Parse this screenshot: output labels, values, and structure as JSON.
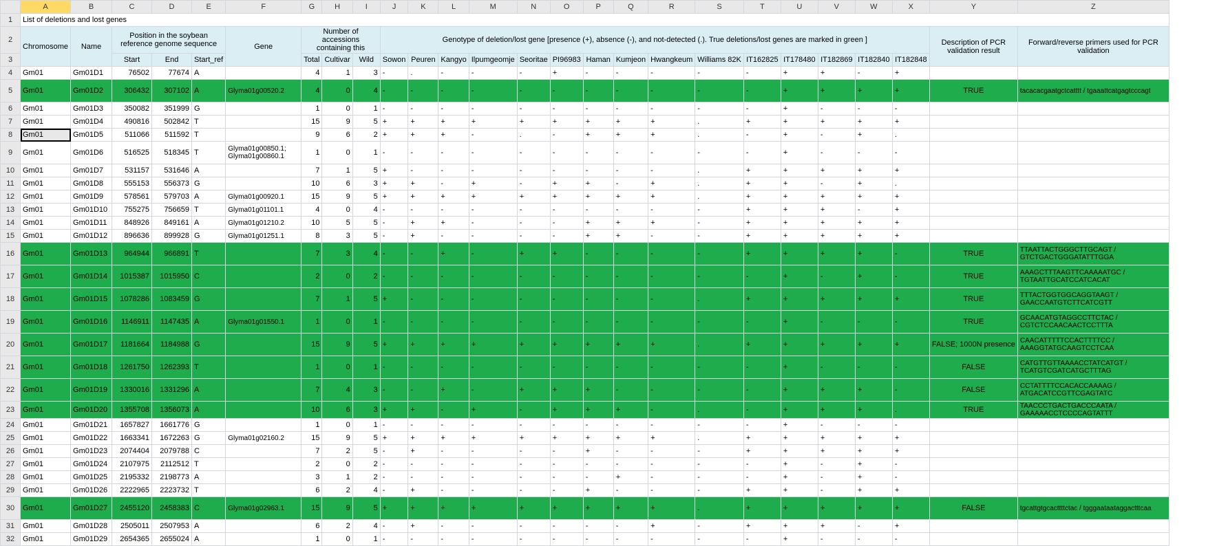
{
  "columns": [
    "",
    "A",
    "B",
    "C",
    "D",
    "E",
    "F",
    "G",
    "H",
    "I",
    "J",
    "K",
    "L",
    "M",
    "N",
    "O",
    "P",
    "Q",
    "R",
    "S",
    "T",
    "U",
    "V",
    "W",
    "X",
    "Y",
    "Z"
  ],
  "row1": {
    "A": "List of deletions and lost genes"
  },
  "row2": {
    "pos_group": "Position in the soybean reference genome sequence",
    "num_group": "Number of accessions containing this",
    "geno_group": "Genotype of deletion/lost gene [presence (+), absence (-), and not-detected (.). True deletions/lost genes are marked in green ]",
    "pcr": "Description of PCR validation result",
    "primers": "Forward/reverse primers used for PCR validation"
  },
  "row3": {
    "A": "Chromosome",
    "B": "Name",
    "C": "Start",
    "D": "End",
    "E": "Start_ref",
    "F": "Gene",
    "G": "Total",
    "H": "Cultivar",
    "I": "Wild",
    "J": "Sowon",
    "K": "Peuren",
    "L": "Kangyo",
    "M": "Ilpumgeomje",
    "N": "Seoritae",
    "O": "PI96983",
    "P": "Haman",
    "Q": "Kumjeon",
    "R": "Hwangkeum",
    "S": "Williams 82K",
    "T": "IT162825",
    "U": "IT178480",
    "V": "IT182869",
    "W": "IT182840",
    "X": "IT182848"
  },
  "rows": [
    {
      "n": 4,
      "A": "Gm01",
      "B": "Gm01D1",
      "C": "76502",
      "D": "77674",
      "E": "A",
      "F": "",
      "G": "4",
      "H": "1",
      "I": "3",
      "J": "-",
      "K": ".",
      "L": "-",
      "M": "-",
      "N": "-",
      "O": "+",
      "P": "-",
      "Q": "-",
      "R": "-",
      "S": "-",
      "T": "-",
      "U": "+",
      "V": "+",
      "W": "-",
      "X": "+",
      "Y": "",
      "Z": ""
    },
    {
      "n": 5,
      "green": true,
      "tall": true,
      "A": "Gm01",
      "B": "Gm01D2",
      "C": "306432",
      "D": "307102",
      "E": "A",
      "F": "Glyma01g00520.2",
      "G": "4",
      "H": "0",
      "I": "4",
      "J": "-",
      "K": "-",
      "L": "-",
      "M": "-",
      "N": "-",
      "O": "-",
      "P": "-",
      "Q": "-",
      "R": "-",
      "S": "-",
      "T": "-",
      "U": "+",
      "V": "+",
      "W": "+",
      "X": "+",
      "Y": "TRUE",
      "Z": "tacacacgaatgctcatttt / tgaaattcatgagtcccagt"
    },
    {
      "n": 6,
      "A": "Gm01",
      "B": "Gm01D3",
      "C": "350082",
      "D": "351999",
      "E": "G",
      "F": "",
      "G": "1",
      "H": "0",
      "I": "1",
      "J": "-",
      "K": "-",
      "L": "-",
      "M": "-",
      "N": "-",
      "O": "-",
      "P": "-",
      "Q": "-",
      "R": "-",
      "S": "-",
      "T": "-",
      "U": "+",
      "V": "-",
      "W": "-",
      "X": "-",
      "Y": "",
      "Z": ""
    },
    {
      "n": 7,
      "A": "Gm01",
      "B": "Gm01D4",
      "C": "490816",
      "D": "502842",
      "E": "T",
      "F": "",
      "G": "15",
      "H": "9",
      "I": "5",
      "J": "+",
      "K": "+",
      "L": "+",
      "M": "+",
      "N": "+",
      "O": "+",
      "P": "+",
      "Q": "+",
      "R": "+",
      "S": ".",
      "T": "+",
      "U": "+",
      "V": "+",
      "W": "+",
      "X": "+",
      "Y": "",
      "Z": ""
    },
    {
      "n": 8,
      "sel": true,
      "A": "Gm01",
      "B": "Gm01D5",
      "C": "511066",
      "D": "511592",
      "E": "T",
      "F": "",
      "G": "9",
      "H": "6",
      "I": "2",
      "J": "+",
      "K": "+",
      "L": "+",
      "M": "-",
      "N": ".",
      "O": "-",
      "P": "+",
      "Q": "+",
      "R": "+",
      "S": ".",
      "T": "-",
      "U": "+",
      "V": "-",
      "W": "+",
      "X": ".",
      "Y": "",
      "Z": ""
    },
    {
      "n": 9,
      "tall": true,
      "A": "Gm01",
      "B": "Gm01D6",
      "C": "516525",
      "D": "518345",
      "E": "T",
      "F": "Glyma01g00850.1; Glyma01g00860.1",
      "G": "1",
      "H": "0",
      "I": "1",
      "J": "-",
      "K": "-",
      "L": "-",
      "M": "-",
      "N": "-",
      "O": "-",
      "P": "-",
      "Q": "-",
      "R": "-",
      "S": "-",
      "T": "-",
      "U": "+",
      "V": "-",
      "W": "-",
      "X": "-",
      "Y": "",
      "Z": ""
    },
    {
      "n": 10,
      "A": "Gm01",
      "B": "Gm01D7",
      "C": "531157",
      "D": "531646",
      "E": "A",
      "F": "",
      "G": "7",
      "H": "1",
      "I": "5",
      "J": "+",
      "K": "-",
      "L": "-",
      "M": "-",
      "N": "-",
      "O": "-",
      "P": "-",
      "Q": "-",
      "R": "-",
      "S": ".",
      "T": "+",
      "U": "+",
      "V": "+",
      "W": "+",
      "X": "+",
      "Y": "",
      "Z": ""
    },
    {
      "n": 11,
      "A": "Gm01",
      "B": "Gm01D8",
      "C": "555153",
      "D": "556373",
      "E": "G",
      "F": "",
      "G": "10",
      "H": "6",
      "I": "3",
      "J": "+",
      "K": "+",
      "L": "-",
      "M": "+",
      "N": "-",
      "O": "+",
      "P": "+",
      "Q": "-",
      "R": "+",
      "S": ".",
      "T": "+",
      "U": "+",
      "V": "-",
      "W": "+",
      "X": ".",
      "Y": "",
      "Z": ""
    },
    {
      "n": 12,
      "A": "Gm01",
      "B": "Gm01D9",
      "C": "578561",
      "D": "579703",
      "E": "A",
      "F": "Glyma01g00920.1",
      "G": "15",
      "H": "9",
      "I": "5",
      "J": "+",
      "K": "+",
      "L": "+",
      "M": "+",
      "N": "+",
      "O": "+",
      "P": "+",
      "Q": "+",
      "R": "+",
      "S": ".",
      "T": "+",
      "U": "+",
      "V": "+",
      "W": "+",
      "X": "+",
      "Y": "",
      "Z": ""
    },
    {
      "n": 13,
      "A": "Gm01",
      "B": "Gm01D10",
      "C": "755275",
      "D": "756659",
      "E": "T",
      "F": "Glyma01g01101.1",
      "G": "4",
      "H": "0",
      "I": "4",
      "J": "-",
      "K": "-",
      "L": "-",
      "M": "-",
      "N": "-",
      "O": "-",
      "P": "-",
      "Q": "-",
      "R": "-",
      "S": "-",
      "T": "+",
      "U": "+",
      "V": "+",
      "W": "-",
      "X": "+",
      "Y": "",
      "Z": ""
    },
    {
      "n": 14,
      "A": "Gm01",
      "B": "Gm01D11",
      "C": "848926",
      "D": "849161",
      "E": "A",
      "F": "Glyma01g01210.2",
      "G": "10",
      "H": "5",
      "I": "5",
      "J": "-",
      "K": "+",
      "L": "+",
      "M": "-",
      "N": "-",
      "O": "-",
      "P": "+",
      "Q": "+",
      "R": "+",
      "S": "-",
      "T": "+",
      "U": "+",
      "V": "+",
      "W": "+",
      "X": "+",
      "Y": "",
      "Z": ""
    },
    {
      "n": 15,
      "A": "Gm01",
      "B": "Gm01D12",
      "C": "896636",
      "D": "899928",
      "E": "G",
      "F": "Glyma01g01251.1",
      "G": "8",
      "H": "3",
      "I": "5",
      "J": "-",
      "K": "+",
      "L": "-",
      "M": "-",
      "N": "-",
      "O": "-",
      "P": "+",
      "Q": "+",
      "R": "-",
      "S": "-",
      "T": "+",
      "U": "+",
      "V": "+",
      "W": "+",
      "X": "+",
      "Y": "",
      "Z": ""
    },
    {
      "n": 16,
      "green": true,
      "tall": true,
      "A": "Gm01",
      "B": "Gm01D13",
      "C": "964944",
      "D": "966891",
      "E": "T",
      "F": "",
      "G": "7",
      "H": "3",
      "I": "4",
      "J": "-",
      "K": "-",
      "L": "+",
      "M": "-",
      "N": "+",
      "O": "+",
      "P": "-",
      "Q": "-",
      "R": "-",
      "S": "-",
      "T": "+",
      "U": "+",
      "V": "+",
      "W": "+",
      "X": "-",
      "Y": "TRUE",
      "Z": "TTAATTACTGGGCTTGCAGT / GTCTGACTGGGATATTTGGA"
    },
    {
      "n": 17,
      "green": true,
      "tall": true,
      "A": "Gm01",
      "B": "Gm01D14",
      "C": "1015387",
      "D": "1015950",
      "E": "C",
      "F": "",
      "G": "2",
      "H": "0",
      "I": "2",
      "J": "-",
      "K": "-",
      "L": "-",
      "M": "-",
      "N": "-",
      "O": "-",
      "P": "-",
      "Q": "-",
      "R": "-",
      "S": "-",
      "T": "-",
      "U": "+",
      "V": "-",
      "W": "+",
      "X": "-",
      "Y": "TRUE",
      "Z": "AAAGCTTTAAGTTCAAAAATGC / TGTAATTGCATCCATCACAT"
    },
    {
      "n": 18,
      "green": true,
      "tall": true,
      "A": "Gm01",
      "B": "Gm01D15",
      "C": "1078286",
      "D": "1083459",
      "E": "G",
      "F": "",
      "G": "7",
      "H": "1",
      "I": "5",
      "J": "+",
      "K": "-",
      "L": "-",
      "M": "-",
      "N": "-",
      "O": "-",
      "P": "-",
      "Q": "-",
      "R": "-",
      "S": ".",
      "T": "+",
      "U": "+",
      "V": "+",
      "W": "+",
      "X": "+",
      "Y": "TRUE",
      "Z": "TTTACTGGTGGCAGGTAAGT / GAACCAATGTCTTCATCGTT"
    },
    {
      "n": 19,
      "green": true,
      "tall": true,
      "A": "Gm01",
      "B": "Gm01D16",
      "C": "1146911",
      "D": "1147435",
      "E": "A",
      "F": "Glyma01g01550.1",
      "G": "1",
      "H": "0",
      "I": "1",
      "J": "-",
      "K": "-",
      "L": "-",
      "M": "-",
      "N": "-",
      "O": "-",
      "P": "-",
      "Q": "-",
      "R": "-",
      "S": "-",
      "T": "-",
      "U": "+",
      "V": "-",
      "W": "-",
      "X": "-",
      "Y": "TRUE",
      "Z": "GCAACATGTAGGCCTTCTAC / CGTCTCCAACAACTCCTTTA"
    },
    {
      "n": 20,
      "green": true,
      "tall": true,
      "A": "Gm01",
      "B": "Gm01D17",
      "C": "1181664",
      "D": "1184988",
      "E": "G",
      "F": "",
      "G": "15",
      "H": "9",
      "I": "5",
      "J": "+",
      "K": "+",
      "L": "+",
      "M": "+",
      "N": "+",
      "O": "+",
      "P": "+",
      "Q": "+",
      "R": "+",
      "S": ".",
      "T": "+",
      "U": "+",
      "V": "+",
      "W": "+",
      "X": "+",
      "Y": "FALSE; 1000N presence",
      "Z": "CAACATTTTTCCACTTTTCC / AAAGGTATGCAAGTCCTCAA"
    },
    {
      "n": 21,
      "green": true,
      "tall": true,
      "A": "Gm01",
      "B": "Gm01D18",
      "C": "1261750",
      "D": "1262393",
      "E": "T",
      "F": "",
      "G": "1",
      "H": "0",
      "I": "1",
      "J": "-",
      "K": "-",
      "L": "-",
      "M": "-",
      "N": "-",
      "O": "-",
      "P": "-",
      "Q": "-",
      "R": "-",
      "S": "-",
      "T": "-",
      "U": "+",
      "V": "-",
      "W": "-",
      "X": "-",
      "Y": "FALSE",
      "Z": "CATGTTGTTAAAACCTATCATGT / TCATGTCGATCATGCTTTAG"
    },
    {
      "n": 22,
      "green": true,
      "tall": true,
      "A": "Gm01",
      "B": "Gm01D19",
      "C": "1330016",
      "D": "1331296",
      "E": "A",
      "F": "",
      "G": "7",
      "H": "4",
      "I": "3",
      "J": "-",
      "K": "-",
      "L": "+",
      "M": "-",
      "N": "+",
      "O": "+",
      "P": "+",
      "Q": "-",
      "R": "-",
      "S": "-",
      "T": "-",
      "U": "+",
      "V": "+",
      "W": "+",
      "X": "-",
      "Y": "FALSE",
      "Z": "CCTATTTTCCACACCAAAAG / ATGACATCCGTTCGAGTATC"
    },
    {
      "n": 23,
      "green": true,
      "mtall": true,
      "A": "Gm01",
      "B": "Gm01D20",
      "C": "1355708",
      "D": "1356073",
      "E": "A",
      "F": "",
      "G": "10",
      "H": "6",
      "I": "3",
      "J": "+",
      "K": "+",
      "L": "-",
      "M": "+",
      "N": "-",
      "O": "+",
      "P": "+",
      "Q": "+",
      "R": "-",
      "S": ".",
      "T": "-",
      "U": "+",
      "V": "+",
      "W": "+",
      "X": ".",
      "Y": "TRUE",
      "Z": "TAACCCTGACTGACCCAATA / GAAAAACCTCCCCAGTATTT"
    },
    {
      "n": 24,
      "A": "Gm01",
      "B": "Gm01D21",
      "C": "1657827",
      "D": "1661776",
      "E": "G",
      "F": "",
      "G": "1",
      "H": "0",
      "I": "1",
      "J": "-",
      "K": "-",
      "L": "-",
      "M": "-",
      "N": "-",
      "O": "-",
      "P": "-",
      "Q": "-",
      "R": "-",
      "S": "-",
      "T": "-",
      "U": "+",
      "V": "-",
      "W": "-",
      "X": "-",
      "Y": "",
      "Z": ""
    },
    {
      "n": 25,
      "A": "Gm01",
      "B": "Gm01D22",
      "C": "1663341",
      "D": "1672263",
      "E": "G",
      "F": "Glyma01g02160.2",
      "G": "15",
      "H": "9",
      "I": "5",
      "J": "+",
      "K": "+",
      "L": "+",
      "M": "+",
      "N": "+",
      "O": "+",
      "P": "+",
      "Q": "+",
      "R": "+",
      "S": ".",
      "T": "+",
      "U": "+",
      "V": "+",
      "W": "+",
      "X": "+",
      "Y": "",
      "Z": ""
    },
    {
      "n": 26,
      "A": "Gm01",
      "B": "Gm01D23",
      "C": "2074404",
      "D": "2079788",
      "E": "C",
      "F": "",
      "G": "7",
      "H": "2",
      "I": "5",
      "J": "-",
      "K": "+",
      "L": "-",
      "M": "-",
      "N": "-",
      "O": "-",
      "P": "+",
      "Q": "-",
      "R": "-",
      "S": "-",
      "T": "+",
      "U": "+",
      "V": "+",
      "W": "+",
      "X": "+",
      "Y": "",
      "Z": ""
    },
    {
      "n": 27,
      "A": "Gm01",
      "B": "Gm01D24",
      "C": "2107975",
      "D": "2112512",
      "E": "T",
      "F": "",
      "G": "2",
      "H": "0",
      "I": "2",
      "J": "-",
      "K": "-",
      "L": "-",
      "M": "-",
      "N": "-",
      "O": "-",
      "P": "-",
      "Q": "-",
      "R": "-",
      "S": "-",
      "T": "-",
      "U": "+",
      "V": "-",
      "W": "+",
      "X": "-",
      "Y": "",
      "Z": ""
    },
    {
      "n": 28,
      "A": "Gm01",
      "B": "Gm01D25",
      "C": "2195332",
      "D": "2198773",
      "E": "A",
      "F": "",
      "G": "3",
      "H": "1",
      "I": "2",
      "J": "-",
      "K": "-",
      "L": "-",
      "M": "-",
      "N": "-",
      "O": "-",
      "P": "-",
      "Q": "+",
      "R": "-",
      "S": "-",
      "T": "-",
      "U": "+",
      "V": "-",
      "W": "+",
      "X": "-",
      "Y": "",
      "Z": ""
    },
    {
      "n": 29,
      "A": "Gm01",
      "B": "Gm01D26",
      "C": "2222965",
      "D": "2223732",
      "E": "T",
      "F": "",
      "G": "6",
      "H": "2",
      "I": "4",
      "J": "-",
      "K": "+",
      "L": "-",
      "M": "-",
      "N": "-",
      "O": "-",
      "P": "+",
      "Q": "-",
      "R": "-",
      "S": "-",
      "T": "+",
      "U": "+",
      "V": "-",
      "W": "+",
      "X": "+",
      "Y": "",
      "Z": ""
    },
    {
      "n": 30,
      "green": true,
      "tall": true,
      "A": "Gm01",
      "B": "Gm01D27",
      "C": "2455120",
      "D": "2458383",
      "E": "C",
      "F": "Glyma01g02963.1",
      "G": "15",
      "H": "9",
      "I": "5",
      "J": "+",
      "K": "+",
      "L": "+",
      "M": "+",
      "N": "+",
      "O": "+",
      "P": "+",
      "Q": "+",
      "R": "+",
      "S": ".",
      "T": "+",
      "U": "+",
      "V": "+",
      "W": "+",
      "X": "+",
      "Y": "FALSE",
      "Z": "tgcattgtgcacttttctac / tgggaataataggactttcaa"
    },
    {
      "n": 31,
      "A": "Gm01",
      "B": "Gm01D28",
      "C": "2505011",
      "D": "2507953",
      "E": "A",
      "F": "",
      "G": "6",
      "H": "2",
      "I": "4",
      "J": "-",
      "K": "+",
      "L": "-",
      "M": "-",
      "N": "-",
      "O": "-",
      "P": "-",
      "Q": "-",
      "R": "+",
      "S": "-",
      "T": "+",
      "U": "+",
      "V": "+",
      "W": "-",
      "X": "+",
      "Y": "",
      "Z": ""
    },
    {
      "n": 32,
      "A": "Gm01",
      "B": "Gm01D29",
      "C": "2654365",
      "D": "2655024",
      "E": "A",
      "F": "",
      "G": "1",
      "H": "0",
      "I": "1",
      "J": "-",
      "K": "-",
      "L": "-",
      "M": "-",
      "N": "-",
      "O": "-",
      "P": "-",
      "Q": "-",
      "R": "-",
      "S": "-",
      "T": "-",
      "U": "+",
      "V": "-",
      "W": "-",
      "X": "-",
      "Y": "",
      "Z": ""
    }
  ]
}
